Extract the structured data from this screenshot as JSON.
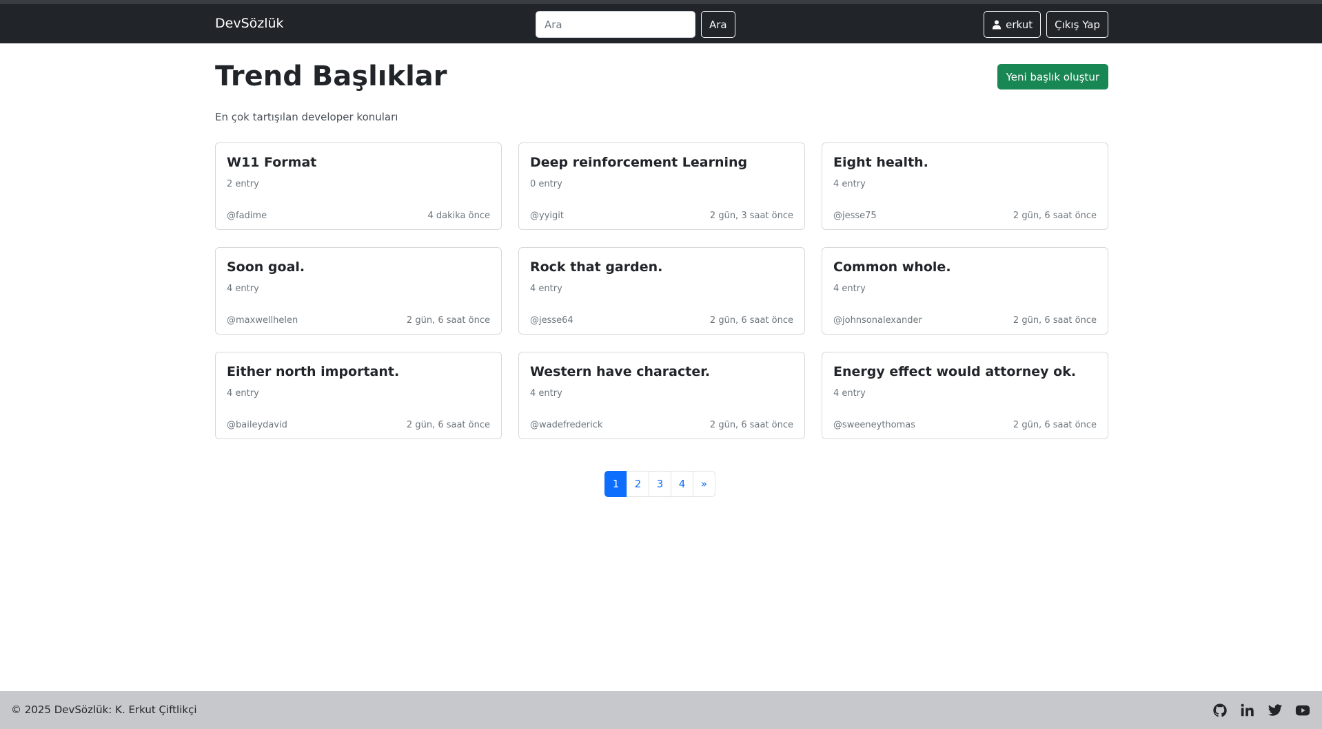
{
  "navbar": {
    "brand": "DevSözlük",
    "search_placeholder": "Ara",
    "search_button": "Ara",
    "username": "erkut",
    "logout": "Çıkış Yap"
  },
  "page": {
    "title": "Trend Başlıklar",
    "subtitle": "En çok tartışılan developer konuları",
    "new_topic_button": "Yeni başlık oluştur"
  },
  "topics": [
    {
      "title": "W11 Format",
      "entries": "2 entry",
      "author": "@fadime",
      "time": "4 dakika önce"
    },
    {
      "title": "Deep reinforcement Learning",
      "entries": "0 entry",
      "author": "@yyigit",
      "time": "2 gün, 3 saat önce"
    },
    {
      "title": "Eight health.",
      "entries": "4 entry",
      "author": "@jesse75",
      "time": "2 gün, 6 saat önce"
    },
    {
      "title": "Soon goal.",
      "entries": "4 entry",
      "author": "@maxwellhelen",
      "time": "2 gün, 6 saat önce"
    },
    {
      "title": "Rock that garden.",
      "entries": "4 entry",
      "author": "@jesse64",
      "time": "2 gün, 6 saat önce"
    },
    {
      "title": "Common whole.",
      "entries": "4 entry",
      "author": "@johnsonalexander",
      "time": "2 gün, 6 saat önce"
    },
    {
      "title": "Either north important.",
      "entries": "4 entry",
      "author": "@baileydavid",
      "time": "2 gün, 6 saat önce"
    },
    {
      "title": "Western have character.",
      "entries": "4 entry",
      "author": "@wadefrederick",
      "time": "2 gün, 6 saat önce"
    },
    {
      "title": "Energy effect would attorney ok.",
      "entries": "4 entry",
      "author": "@sweeneythomas",
      "time": "2 gün, 6 saat önce"
    }
  ],
  "pagination": {
    "pages": [
      "1",
      "2",
      "3",
      "4"
    ],
    "active": "1",
    "next": "»"
  },
  "footer": {
    "text": "© 2025 DevSözlük: K. Erkut Çiftlikçi",
    "social": [
      "github-icon",
      "linkedin-icon",
      "twitter-icon",
      "youtube-icon"
    ]
  },
  "colors": {
    "navbar_bg": "#212529",
    "primary": "#0d6efd",
    "success": "#198754",
    "footer_bg": "#c6c8cb"
  }
}
